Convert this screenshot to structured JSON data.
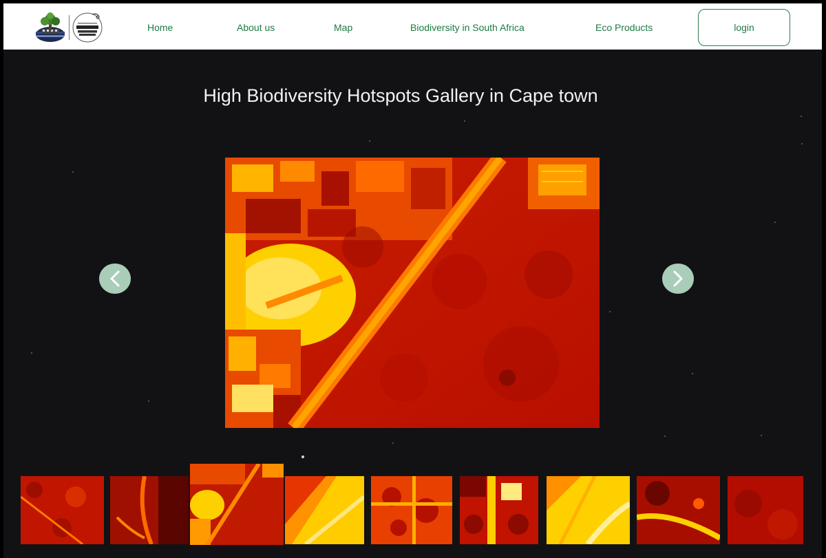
{
  "header": {
    "logo_alt": "Biodiversity logo",
    "spaceapps_alt": "International Space Apps Challenge",
    "nav": [
      {
        "label": "Home"
      },
      {
        "label": "About us"
      },
      {
        "label": "Map"
      },
      {
        "label": "Biodiversity in South Africa"
      },
      {
        "label": "Eco Products"
      }
    ],
    "login_label": "login"
  },
  "gallery": {
    "title": "High Biodiversity Hotspots Gallery in Cape town",
    "prev_icon": "chevron-left-icon",
    "next_icon": "chevron-right-icon",
    "selected_index": 2,
    "thumbnail_count": 9
  },
  "colors": {
    "accent_green": "#1e7a43",
    "arrow_bg": "#a9cdb9",
    "background": "#121214",
    "heat_dark": "#b50d02",
    "heat_mid": "#e83a00",
    "heat_light": "#ffd000"
  }
}
